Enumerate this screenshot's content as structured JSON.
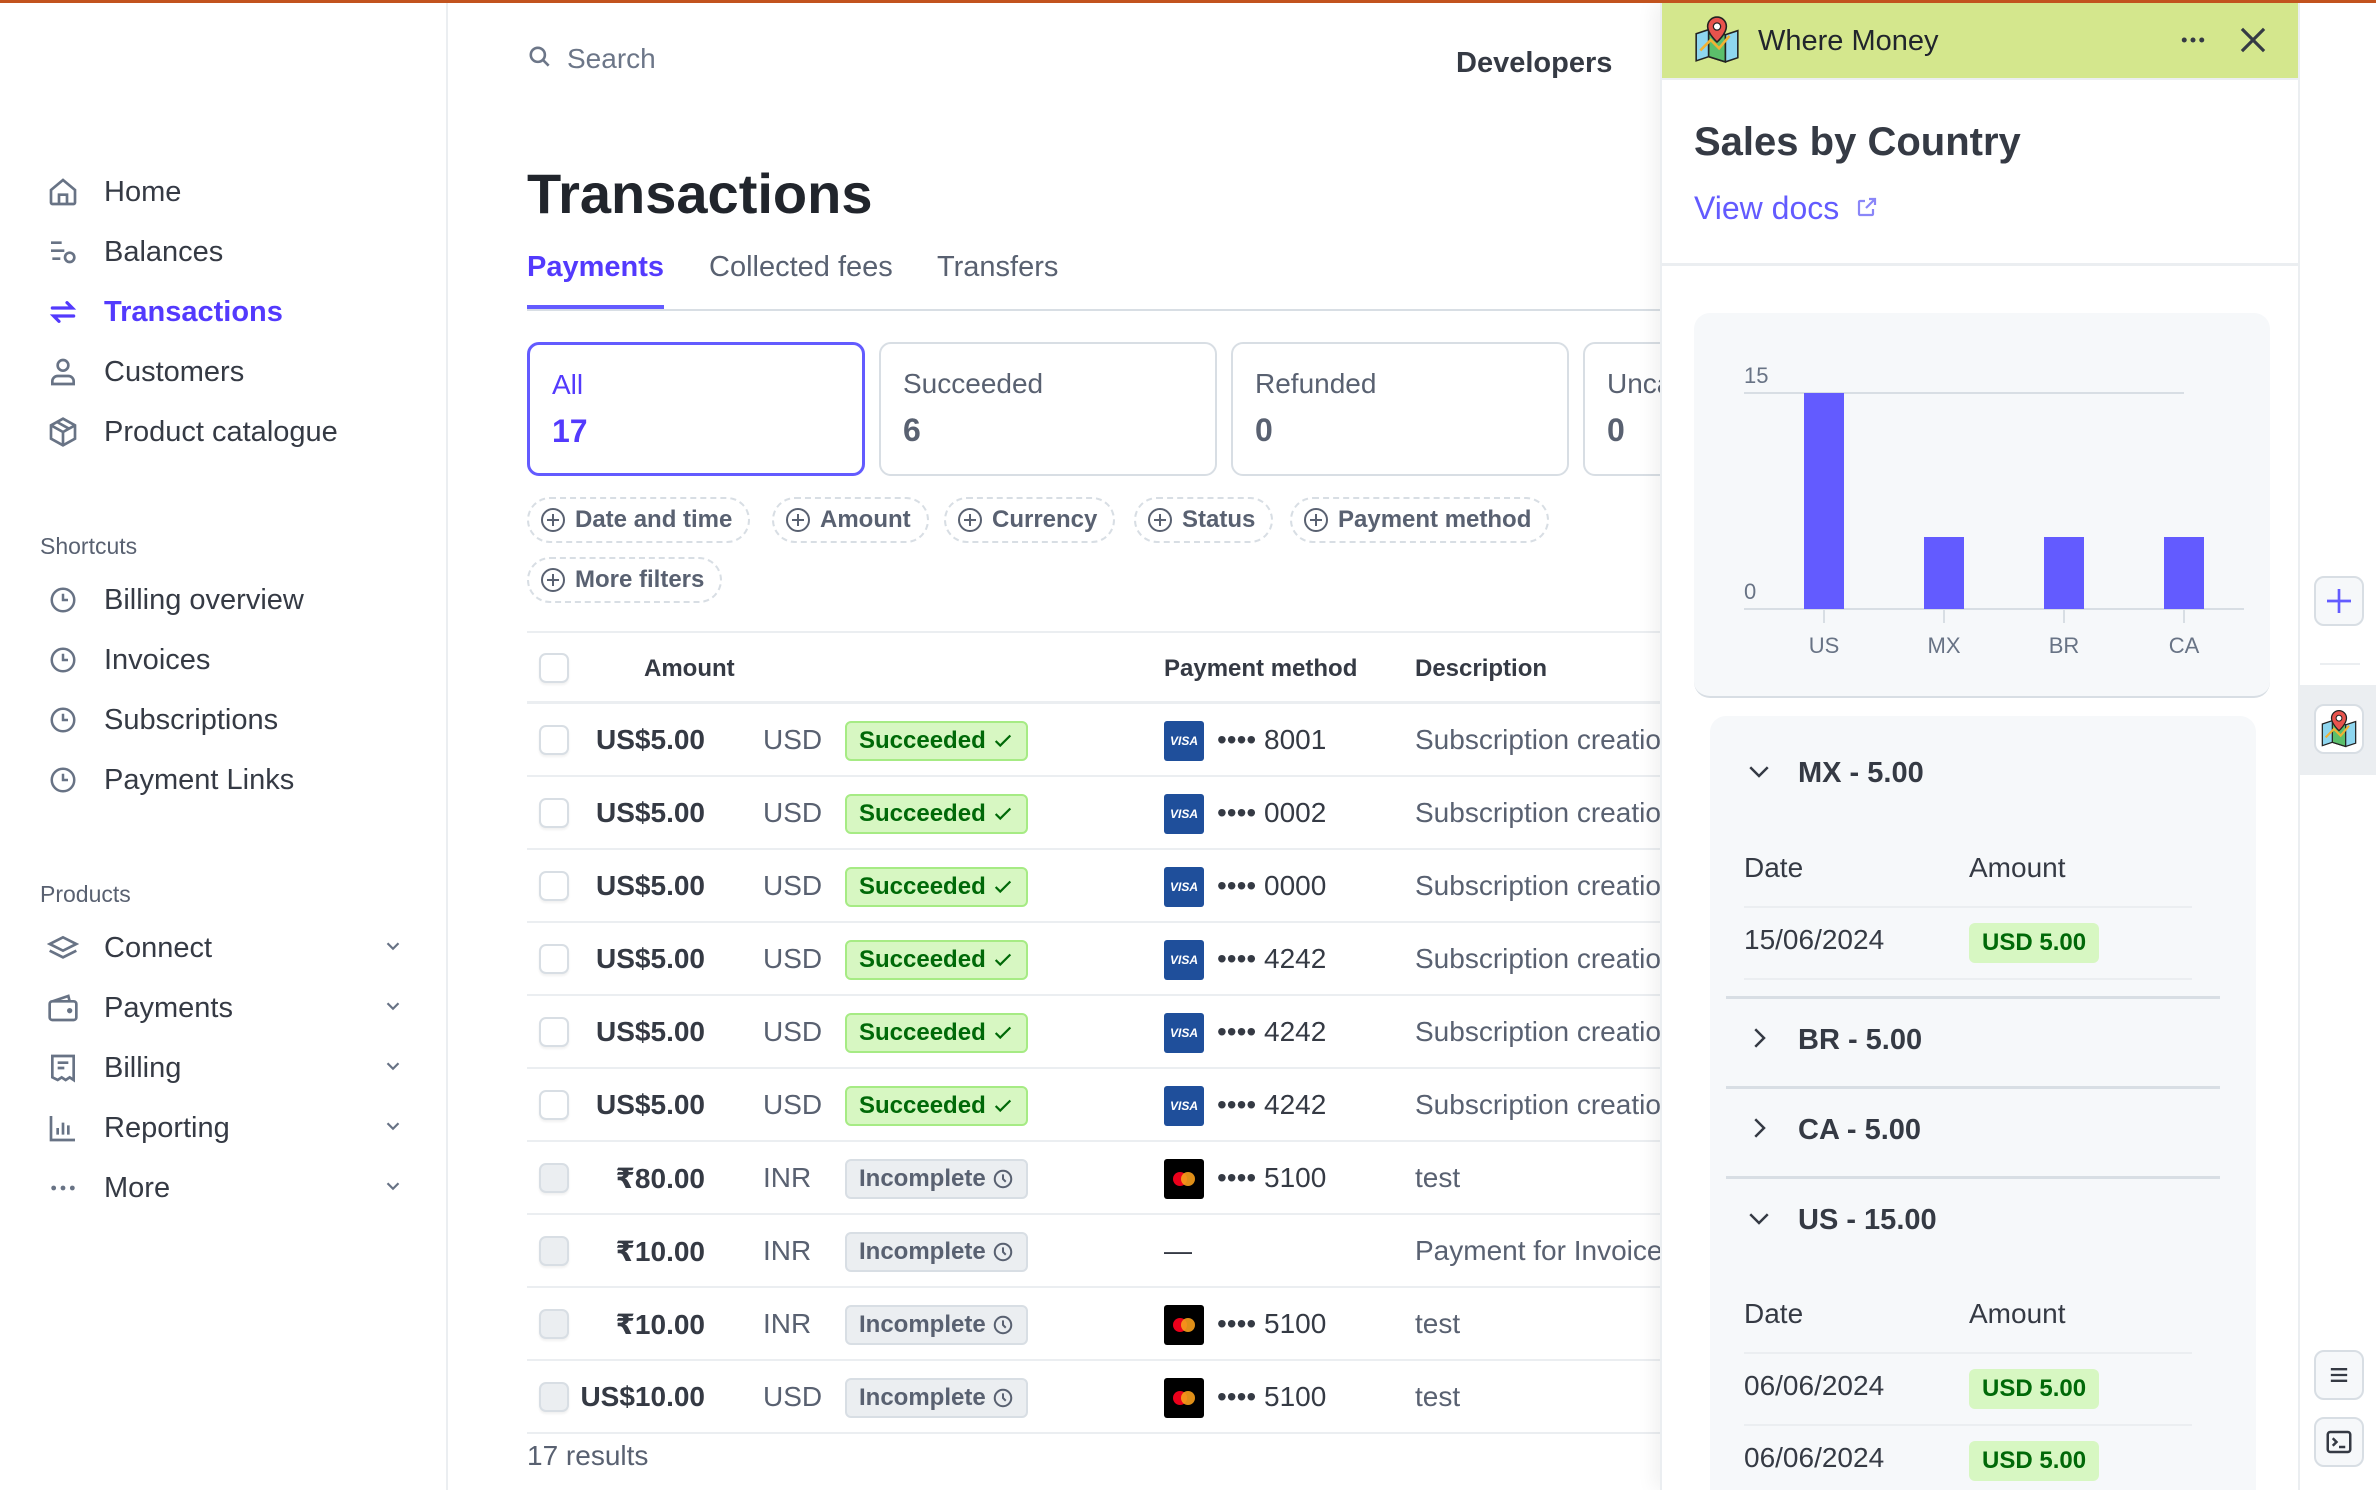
{
  "sidebar": {
    "nav": [
      {
        "label": "Home",
        "icon": "home-icon"
      },
      {
        "label": "Balances",
        "icon": "balances-icon"
      },
      {
        "label": "Transactions",
        "icon": "transactions-icon",
        "active": true
      },
      {
        "label": "Customers",
        "icon": "customer-icon"
      },
      {
        "label": "Product catalogue",
        "icon": "box-icon"
      }
    ],
    "shortcuts_label": "Shortcuts",
    "shortcuts": [
      {
        "label": "Billing overview",
        "icon": "clock-icon"
      },
      {
        "label": "Invoices",
        "icon": "clock-icon"
      },
      {
        "label": "Subscriptions",
        "icon": "clock-icon"
      },
      {
        "label": "Payment Links",
        "icon": "clock-icon"
      }
    ],
    "products_label": "Products",
    "products": [
      {
        "label": "Connect",
        "icon": "layers-icon"
      },
      {
        "label": "Payments",
        "icon": "wallet-icon"
      },
      {
        "label": "Billing",
        "icon": "receipt-icon"
      },
      {
        "label": "Reporting",
        "icon": "bar-chart-icon"
      },
      {
        "label": "More",
        "icon": "ellipsis-icon"
      }
    ]
  },
  "header": {
    "search_placeholder": "Search",
    "developers_label": "Developers"
  },
  "page": {
    "title": "Transactions",
    "tabs": [
      {
        "label": "Payments",
        "active": true
      },
      {
        "label": "Collected fees"
      },
      {
        "label": "Transfers"
      }
    ],
    "status_cards": [
      {
        "label": "All",
        "count": "17",
        "active": true
      },
      {
        "label": "Succeeded",
        "count": "6"
      },
      {
        "label": "Refunded",
        "count": "0"
      },
      {
        "label": "Uncaptured",
        "count": "0"
      }
    ],
    "filters": [
      "Date and time",
      "Amount",
      "Currency",
      "Status",
      "Payment method",
      "More filters"
    ],
    "table": {
      "columns": [
        "Amount",
        "Payment method",
        "Description"
      ],
      "rows": [
        {
          "amount": "US$5.00",
          "currency": "USD",
          "status": "Succeeded",
          "status_type": "ok",
          "card_brand": "visa",
          "card_label": "VISA",
          "last4": "•••• 8001",
          "description": "Subscription creation"
        },
        {
          "amount": "US$5.00",
          "currency": "USD",
          "status": "Succeeded",
          "status_type": "ok",
          "card_brand": "visa",
          "card_label": "VISA",
          "last4": "•••• 0002",
          "description": "Subscription creation"
        },
        {
          "amount": "US$5.00",
          "currency": "USD",
          "status": "Succeeded",
          "status_type": "ok",
          "card_brand": "visa",
          "card_label": "VISA",
          "last4": "•••• 0000",
          "description": "Subscription creation"
        },
        {
          "amount": "US$5.00",
          "currency": "USD",
          "status": "Succeeded",
          "status_type": "ok",
          "card_brand": "visa",
          "card_label": "VISA",
          "last4": "•••• 4242",
          "description": "Subscription creation"
        },
        {
          "amount": "US$5.00",
          "currency": "USD",
          "status": "Succeeded",
          "status_type": "ok",
          "card_brand": "visa",
          "card_label": "VISA",
          "last4": "•••• 4242",
          "description": "Subscription creation"
        },
        {
          "amount": "US$5.00",
          "currency": "USD",
          "status": "Succeeded",
          "status_type": "ok",
          "card_brand": "visa",
          "card_label": "VISA",
          "last4": "•••• 4242",
          "description": "Subscription creation"
        },
        {
          "amount": "₹80.00",
          "currency": "INR",
          "status": "Incomplete",
          "status_type": "inc",
          "card_brand": "mastercard",
          "card_label": "",
          "last4": "•••• 5100",
          "description": "test"
        },
        {
          "amount": "₹10.00",
          "currency": "INR",
          "status": "Incomplete",
          "status_type": "inc",
          "card_brand": "none",
          "card_label": "",
          "last4": "—",
          "description": "Payment for Invoice"
        },
        {
          "amount": "₹10.00",
          "currency": "INR",
          "status": "Incomplete",
          "status_type": "inc",
          "card_brand": "mastercard",
          "card_label": "",
          "last4": "•••• 5100",
          "description": "test"
        },
        {
          "amount": "US$10.00",
          "currency": "USD",
          "status": "Incomplete",
          "status_type": "inc",
          "card_brand": "mastercard",
          "card_label": "",
          "last4": "•••• 5100",
          "description": "test"
        }
      ]
    },
    "results_label": "17 results"
  },
  "panel": {
    "app_name": "Where Money",
    "title": "Sales by Country",
    "view_docs_label": "View docs",
    "header_color": "#d4e78d",
    "accordion": [
      {
        "label": "MX - 5.00",
        "expanded": true,
        "columns": [
          "Date",
          "Amount"
        ],
        "rows": [
          {
            "date": "15/06/2024",
            "amount": "USD 5.00"
          }
        ]
      },
      {
        "label": "BR - 5.00",
        "expanded": false
      },
      {
        "label": "CA - 5.00",
        "expanded": false
      },
      {
        "label": "US - 15.00",
        "expanded": true,
        "columns": [
          "Date",
          "Amount"
        ],
        "rows": [
          {
            "date": "06/06/2024",
            "amount": "USD 5.00"
          },
          {
            "date": "06/06/2024",
            "amount": "USD 5.00"
          }
        ]
      }
    ]
  },
  "colors": {
    "accent": "#533afd",
    "bar": "#635bff",
    "success_bg": "#d7f7c2",
    "success_text": "#006908",
    "top_bar": "#c2531e"
  },
  "chart_data": {
    "type": "bar",
    "title": "Sales by Country",
    "categories": [
      "US",
      "MX",
      "BR",
      "CA"
    ],
    "values": [
      15,
      5,
      5,
      5
    ],
    "xlabel": "",
    "ylabel": "",
    "ylim": [
      0,
      15
    ],
    "yticks": [
      0,
      15
    ],
    "grid": true,
    "legend": "none"
  }
}
